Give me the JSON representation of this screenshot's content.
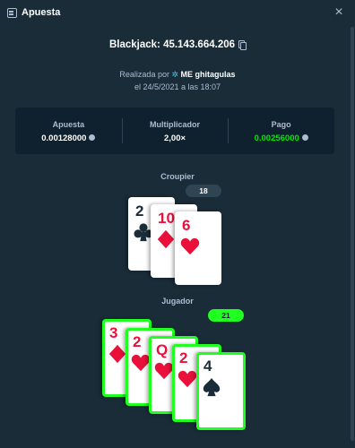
{
  "header": {
    "title": "Apuesta",
    "icon": "bet-slip-icon",
    "close_icon": "close-icon",
    "close_label": "×"
  },
  "game": {
    "title": "Blackjack: 45.143.664.206"
  },
  "placed": {
    "prefix": "Realizada por",
    "user": "ME ghitagulas",
    "date": "el 24/5/2021 a las 18:07"
  },
  "stats": {
    "bet_label": "Apuesta",
    "bet_value": "0.00128000",
    "multiplier_label": "Multiplicador",
    "multiplier_value": "2,00×",
    "payout_label": "Pago",
    "payout_value": "0.00256000"
  },
  "dealer": {
    "label": "Croupier",
    "score": "18",
    "cards": [
      {
        "rank": "2",
        "suit": "clubs",
        "color": "black"
      },
      {
        "rank": "10",
        "suit": "diamonds",
        "color": "red"
      },
      {
        "rank": "6",
        "suit": "hearts",
        "color": "red"
      }
    ]
  },
  "player": {
    "label": "Jugador",
    "score": "21",
    "cards": [
      {
        "rank": "3",
        "suit": "diamonds",
        "color": "red"
      },
      {
        "rank": "2",
        "suit": "hearts",
        "color": "red"
      },
      {
        "rank": "Q",
        "suit": "hearts",
        "color": "red"
      },
      {
        "rank": "2",
        "suit": "hearts",
        "color": "red"
      },
      {
        "rank": "4",
        "suit": "spades",
        "color": "black"
      }
    ]
  },
  "colors": {
    "background": "#1a2c38",
    "panel": "#0f212e",
    "win": "#1fff20",
    "payout": "#00e701",
    "red_suit": "#e9113c"
  }
}
